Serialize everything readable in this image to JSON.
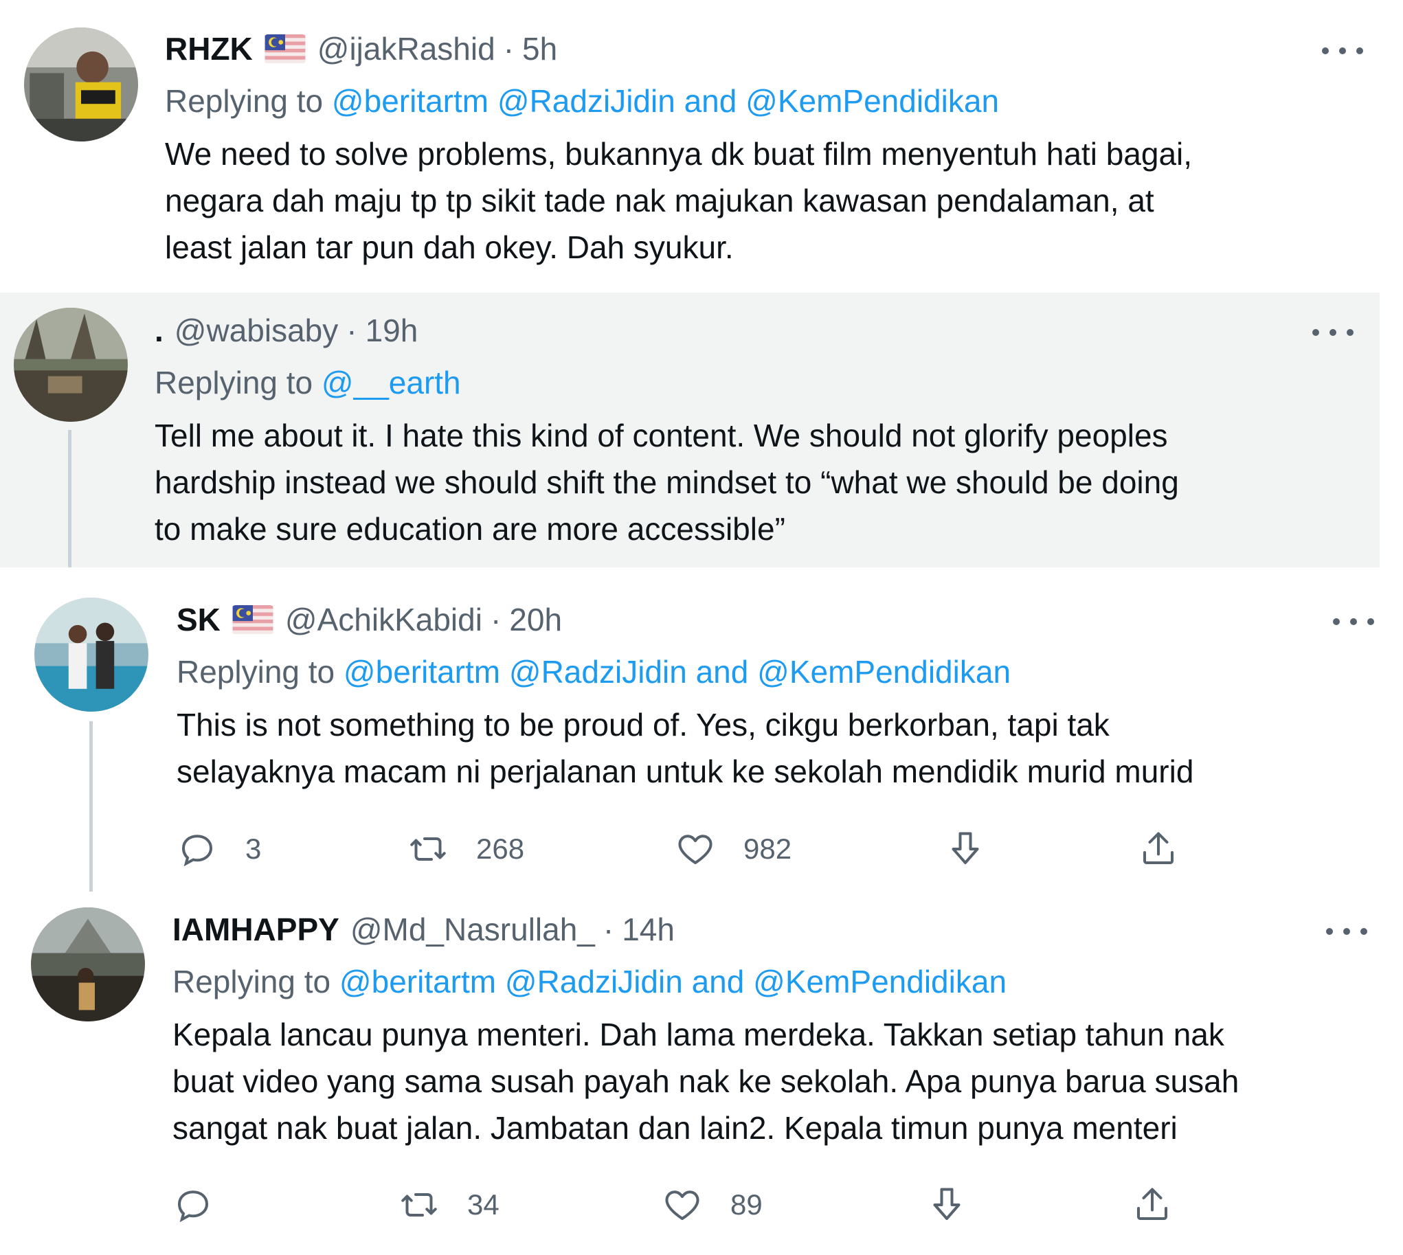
{
  "replying_label": "Replying to",
  "dot": "·",
  "tweets": [
    {
      "name": "RHZK",
      "has_flag": true,
      "handle": "@ijakRashid",
      "time": "5h",
      "mentions": [
        "@beritartm",
        "@RadziJidin"
      ],
      "and_word": "and",
      "last_mention": "@KemPendidikan",
      "lines": [
        "We need to solve problems, bukannya dk buat film menyentuh hati bagai,",
        "negara dah maju tp tp sikit tade nak majukan kawasan pendalaman, at",
        "least jalan tar pun dah okey. Dah syukur."
      ]
    },
    {
      "name": ".",
      "has_flag": false,
      "handle": "@wabisaby",
      "time": "19h",
      "mentions": [
        "@__earth"
      ],
      "lines": [
        "Tell me about it. I hate this kind of content. We should not glorify peoples",
        "hardship instead we should shift the mindset to “what we should be doing",
        "to make sure education are more accessible”"
      ]
    },
    {
      "name": "SK",
      "has_flag": true,
      "handle": "@AchikKabidi",
      "time": "20h",
      "mentions": [
        "@beritartm",
        "@RadziJidin"
      ],
      "and_word": "and",
      "last_mention": "@KemPendidikan",
      "lines": [
        "This is not something to be proud of. Yes, cikgu berkorban, tapi tak",
        "selayaknya macam ni perjalanan untuk ke sekolah mendidik murid murid"
      ],
      "actions": {
        "replies": "3",
        "retweets": "268",
        "likes": "982"
      }
    },
    {
      "name": "IAMHAPPY",
      "has_flag": false,
      "handle": "@Md_Nasrullah_",
      "time": "14h",
      "mentions": [
        "@beritartm",
        "@RadziJidin"
      ],
      "and_word": "and",
      "last_mention": "@KemPendidikan",
      "lines": [
        "Kepala lancau punya menteri. Dah lama merdeka. Takkan setiap tahun nak",
        "buat video yang sama susah payah nak ke sekolah. Apa punya barua susah",
        "sangat nak buat jalan. Jambatan dan lain2. Kepala timun punya menteri"
      ],
      "actions": {
        "replies": "",
        "retweets": "34",
        "likes": "89"
      }
    }
  ],
  "icons": {
    "reply": "reply-icon",
    "retweet": "retweet-icon",
    "like": "heart-icon",
    "downvote": "downvote-icon",
    "share": "share-icon",
    "more": "more-icon"
  },
  "colors": {
    "link": "#1d9bf0",
    "muted": "#56636f",
    "highlight_bg": "#f2f3f3",
    "thread_line": "#c9d2d9"
  }
}
